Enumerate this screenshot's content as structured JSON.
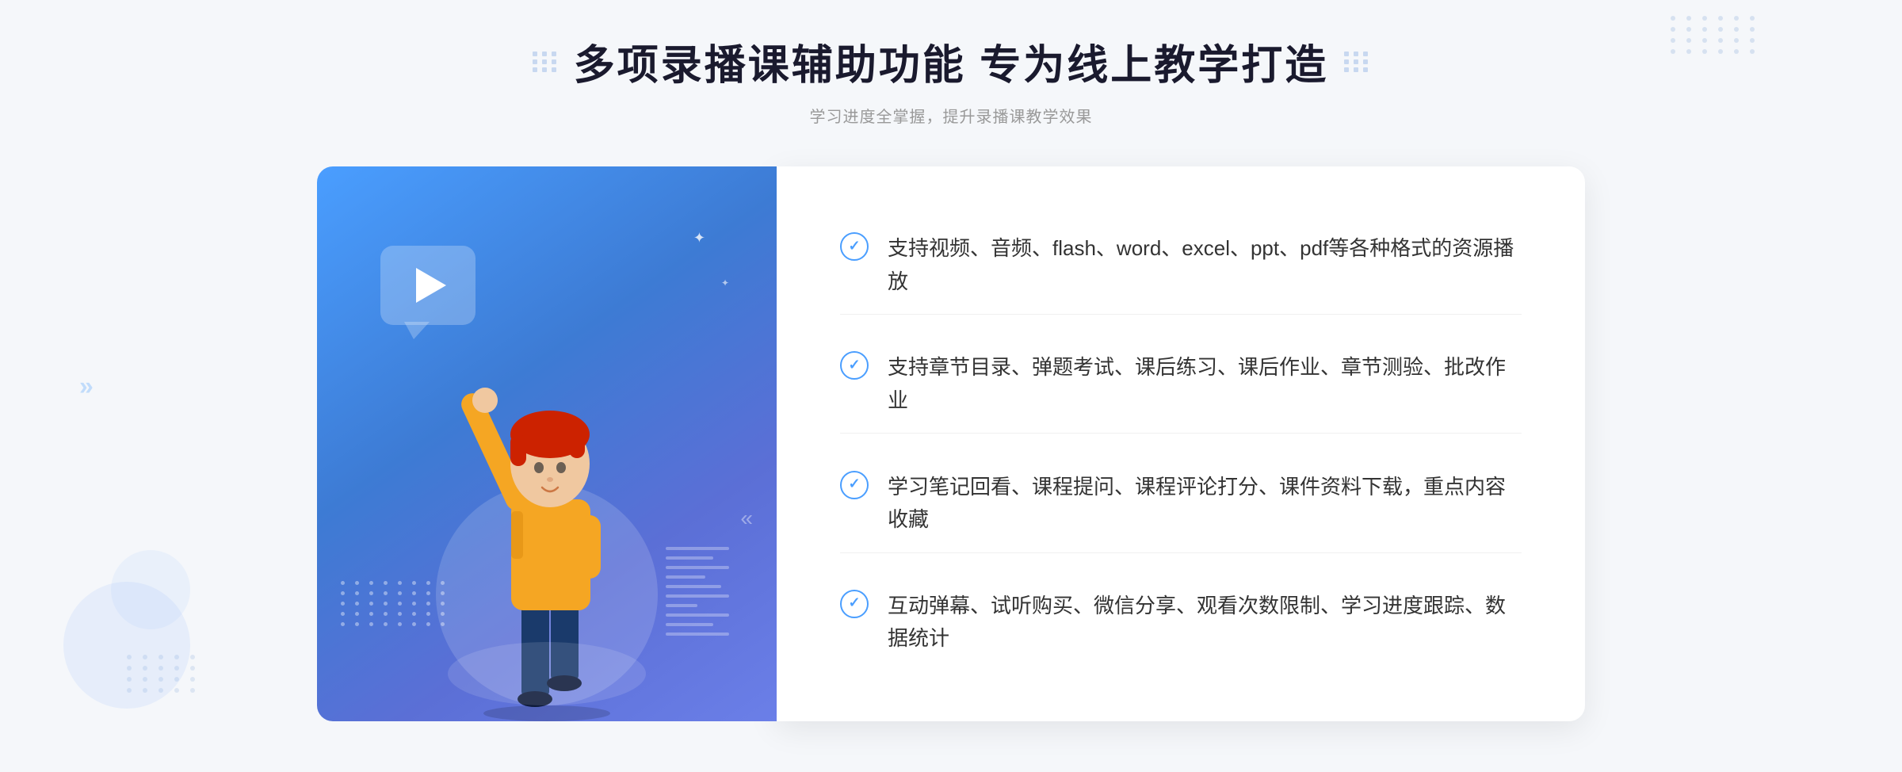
{
  "header": {
    "main_title": "多项录播课辅助功能 专为线上教学打造",
    "subtitle": "学习进度全掌握，提升录播课教学效果"
  },
  "features": [
    {
      "id": "feature-1",
      "text": "支持视频、音频、flash、word、excel、ppt、pdf等各种格式的资源播放"
    },
    {
      "id": "feature-2",
      "text": "支持章节目录、弹题考试、课后练习、课后作业、章节测验、批改作业"
    },
    {
      "id": "feature-3",
      "text": "学习笔记回看、课程提问、课程评论打分、课件资料下载，重点内容收藏"
    },
    {
      "id": "feature-4",
      "text": "互动弹幕、试听购买、微信分享、观看次数限制、学习进度跟踪、数据统计"
    }
  ],
  "decoration": {
    "left_arrows": "«",
    "check_mark": "✓"
  },
  "colors": {
    "primary_blue": "#4a9eff",
    "dark_blue": "#3d7bd4",
    "title_color": "#1a1a2e",
    "subtitle_color": "#999999",
    "text_color": "#333333",
    "border_color": "#f0f0f0",
    "dot_color": "#c8d8f0"
  }
}
